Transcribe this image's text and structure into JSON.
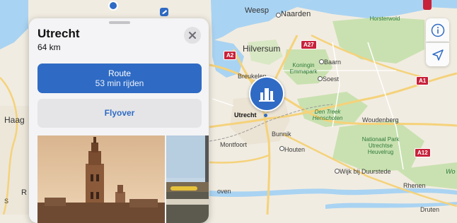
{
  "place": {
    "title": "Utrecht",
    "distance": "64 km"
  },
  "actions": {
    "route_label": "Route",
    "route_duration": "53 min rijden",
    "flyover_label": "Flyover"
  },
  "map": {
    "labels": {
      "weesp": "Weesp",
      "naarden": "Naarden",
      "horsterwold": "Horsterwold",
      "hilversum": "Hilversum",
      "koningin_emmapark": "Koningin Emmapark",
      "baarn": "Baarn",
      "breukelen": "Breukelen",
      "soest": "Soest",
      "utrecht": "Utrecht",
      "den_treek": "Den Treek Henschoten",
      "woudenberg": "Woudenberg",
      "haag": "Haag",
      "bunnik": "Bunnik",
      "montfoort": "Montfoort",
      "houten": "Houten",
      "nationaal_park": "Nationaal Park Utrechtse Heuvelrug",
      "wijk_bij_duurstede": "Wijk bij Duurstede",
      "rhenen": "Rhenen",
      "druten": "Druten",
      "culemborg_partial": "oven",
      "wo_partial": "Wo",
      "r_partial": "R",
      "s_partial": "S"
    },
    "roads": {
      "a27": "A27",
      "a2": "A2",
      "a1": "A1",
      "a12": "A12"
    }
  },
  "controls": {
    "info_icon": "info-icon",
    "location_icon": "location-arrow-icon"
  },
  "colors": {
    "accent": "#2f6bc4",
    "water": "#a9d3f2",
    "park": "#c9e1b0",
    "road": "#f5d27a",
    "highway_shield": "#c8213a"
  }
}
